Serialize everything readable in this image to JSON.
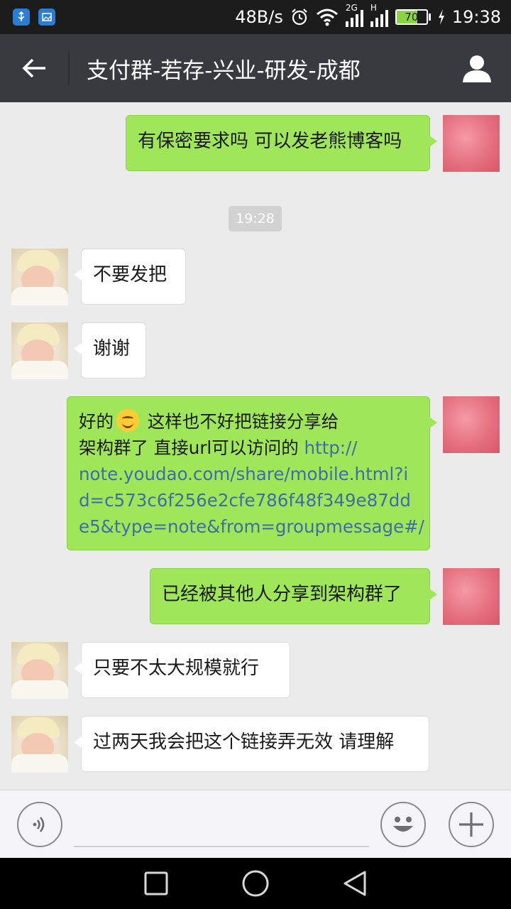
{
  "status_bar": {
    "net_speed": "48B/s",
    "signal_2g": "2G",
    "signal_h": "H",
    "battery_level": "70",
    "battery_fraction": 0.7,
    "time": "19:38"
  },
  "header": {
    "title": "支付群-若存-兴业-研发-成都",
    "back_icon": "arrow-left-icon",
    "profile_icon": "person-icon"
  },
  "messages": [
    {
      "sender": "self",
      "text": "有保密要求吗 可以发老熊博客吗"
    },
    {
      "sender": "other",
      "text": "不要发把"
    },
    {
      "sender": "other",
      "text": "谢谢"
    },
    {
      "sender": "self",
      "text_line1_pre": "好的",
      "text_line1_post": " 这样也不好把链接分享给",
      "text_line2": "架构群了 直接url可以访问的 ",
      "link": "http://note.youdao.com/share/mobile.html?id=c573c6f256e2cfe786f48f349e87dde5&type=note&from=groupmessage#/",
      "link_lines": [
        "http://",
        "note.youdao.com/share/mobile.html?i",
        "d=c573c6f256e2cfe786f48f349e87dd",
        "e5&type=note&from=groupmessage#/"
      ]
    },
    {
      "sender": "self",
      "text": "已经被其他人分享到架构群了"
    },
    {
      "sender": "other",
      "text": "只要不太大规模就行"
    },
    {
      "sender": "other",
      "text": "过两天我会把这个链接弄无效 请理解"
    }
  ],
  "timestamp": "19:28",
  "input_bar": {
    "voice_icon": "voice-icon",
    "emoji_icon": "emoji-icon",
    "plus_icon": "plus-icon",
    "placeholder": ""
  },
  "colors": {
    "outgoing_bubble": "#9fe658",
    "incoming_bubble": "#ffffff",
    "title_bar": "#393a3f",
    "chat_background": "#ebebeb",
    "link": "#3e6ea8"
  }
}
